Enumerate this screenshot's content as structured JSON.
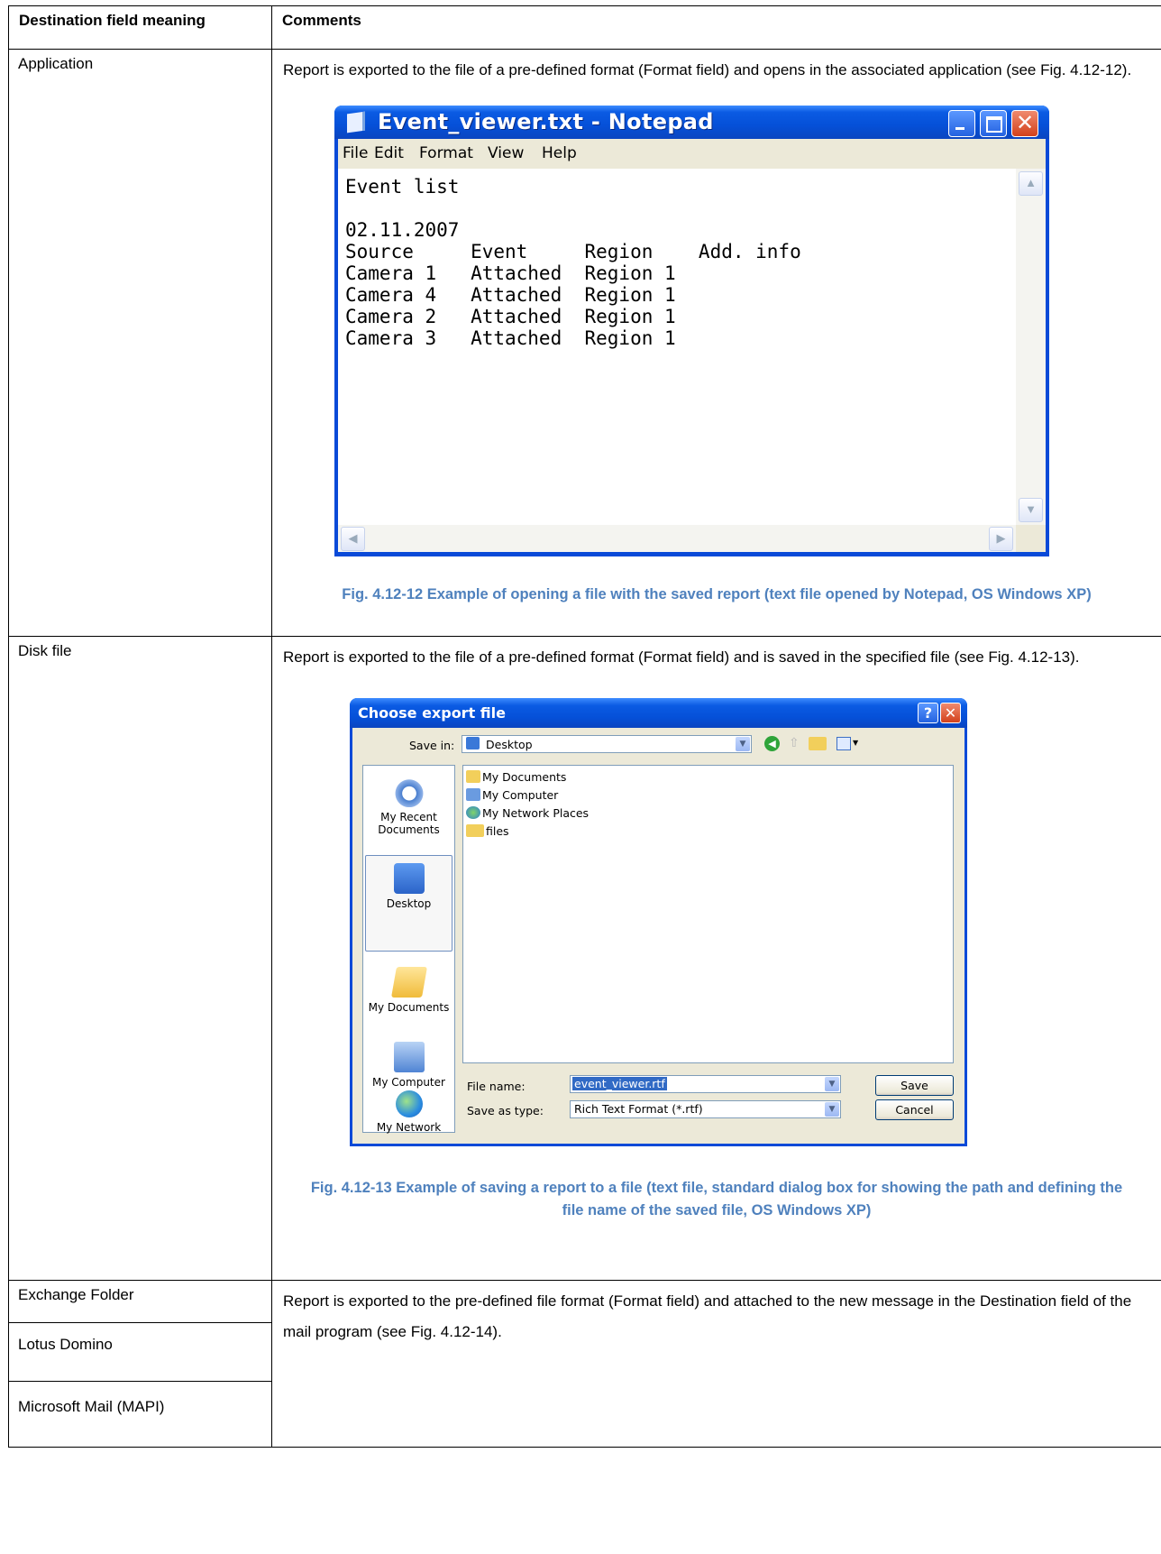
{
  "header": {
    "col1": "Destination field meaning",
    "col2": "Comments"
  },
  "rows": [
    {
      "destination": "Application",
      "comment": "Report is exported to the file of a pre-defined format (Format field) and opens in the associated application (see Fig. 4.12-12).",
      "caption": "Fig. 4.12-12 Example of opening a file with the saved report (text file opened by Notepad, OS Windows XP)"
    },
    {
      "destination": "Disk file",
      "comment": "Report is exported to the file of a pre-defined format (Format field) and is saved in the specified file (see Fig. 4.12-13).",
      "caption": "Fig. 4.12-13 Example of saving a report to a file (text file, standard dialog box for showing the path and defining the file name of the saved file, OS Windows XP)"
    },
    {
      "destinations": [
        "Exchange Folder",
        "Lotus Domino",
        "Microsoft Mail (MAPI)"
      ],
      "comment": "Report is exported to the pre-defined file format (Format field) and attached to the new message in the Destination field of the mail program (see Fig. 4.12-14)."
    }
  ],
  "notepad": {
    "title": "Event_viewer.txt - Notepad",
    "menu": [
      "File",
      "Edit",
      "Format",
      "View",
      "Help"
    ],
    "content": "Event list\n\n02.11.2007\nSource     Event     Region    Add. info\nCamera 1   Attached  Region 1\nCamera 4   Attached  Region 1\nCamera 2   Attached  Region 1\nCamera 3   Attached  Region 1"
  },
  "save_dialog": {
    "title": "Choose export file",
    "save_in_label": "Save in:",
    "save_in_value": "Desktop",
    "places": [
      "My Recent Documents",
      "Desktop",
      "My Documents",
      "My Computer",
      "My Network"
    ],
    "files": [
      "My Documents",
      "My Computer",
      "My Network Places",
      "files"
    ],
    "file_name_label": "File name:",
    "file_name_value": "event_viewer.rtf",
    "save_as_type_label": "Save as type:",
    "save_as_type_value": "Rich Text Format (*.rtf)",
    "save_button": "Save",
    "cancel_button": "Cancel"
  },
  "colors": {
    "caption": "#4f81bd",
    "xp_title": "#0550d8",
    "dialog_bg": "#ece9d8"
  }
}
